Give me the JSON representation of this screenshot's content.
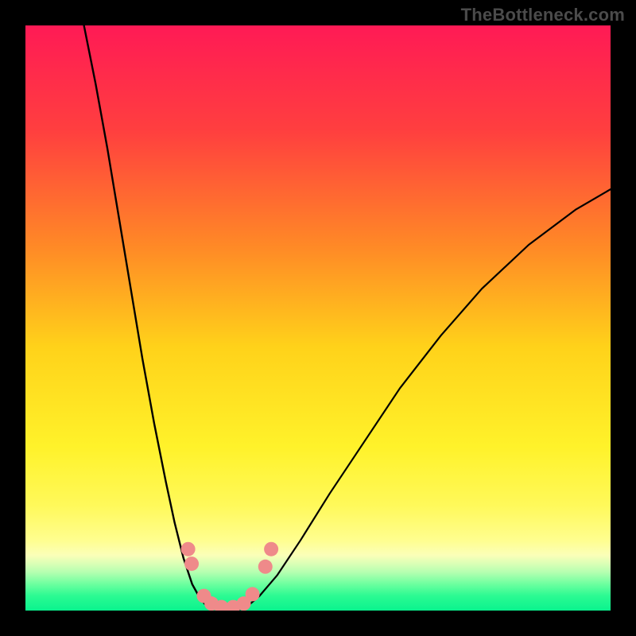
{
  "watermark": "TheBottleneck.com",
  "chart_data": {
    "type": "line",
    "title": "",
    "xlabel": "",
    "ylabel": "",
    "xlim": [
      0,
      100
    ],
    "ylim": [
      0,
      100
    ],
    "grid": false,
    "background_gradient": {
      "stops": [
        {
          "offset": 0.0,
          "color": "#ff1a55"
        },
        {
          "offset": 0.18,
          "color": "#ff3f3f"
        },
        {
          "offset": 0.38,
          "color": "#ff8a26"
        },
        {
          "offset": 0.55,
          "color": "#ffd21a"
        },
        {
          "offset": 0.72,
          "color": "#fff22a"
        },
        {
          "offset": 0.82,
          "color": "#fff95a"
        },
        {
          "offset": 0.88,
          "color": "#fffe8f"
        },
        {
          "offset": 0.905,
          "color": "#fbffb8"
        },
        {
          "offset": 0.92,
          "color": "#daffb6"
        },
        {
          "offset": 0.935,
          "color": "#b3ffb0"
        },
        {
          "offset": 0.955,
          "color": "#6cff9f"
        },
        {
          "offset": 0.975,
          "color": "#2bfa92"
        },
        {
          "offset": 1.0,
          "color": "#0af38e"
        }
      ]
    },
    "series": [
      {
        "name": "left-limb",
        "color": "#000000",
        "width": 2.4,
        "x": [
          10.0,
          12.0,
          14.0,
          16.0,
          18.0,
          20.0,
          22.0,
          24.0,
          25.5,
          27.0,
          28.5,
          30.0,
          31.0
        ],
        "y": [
          100.0,
          90.0,
          79.0,
          67.0,
          55.0,
          43.0,
          32.0,
          22.0,
          15.0,
          9.0,
          4.5,
          1.8,
          0.8
        ]
      },
      {
        "name": "right-limb",
        "color": "#000000",
        "width": 2.2,
        "x": [
          38.0,
          40.0,
          43.0,
          47.0,
          52.0,
          58.0,
          64.0,
          71.0,
          78.0,
          86.0,
          94.0,
          100.0
        ],
        "y": [
          0.8,
          2.5,
          6.0,
          12.0,
          20.0,
          29.0,
          38.0,
          47.0,
          55.0,
          62.5,
          68.5,
          72.0
        ]
      }
    ],
    "floor_path": {
      "name": "valley-floor",
      "color": "#000000",
      "width": 2.0,
      "x": [
        31.0,
        32.5,
        34.0,
        35.5,
        37.0,
        38.0
      ],
      "y": [
        0.8,
        0.25,
        0.05,
        0.05,
        0.25,
        0.8
      ]
    },
    "markers": {
      "name": "valley-markers",
      "color": "#ef8a8a",
      "radius": 9,
      "points": [
        {
          "x": 27.8,
          "y": 10.5
        },
        {
          "x": 28.4,
          "y": 8.0
        },
        {
          "x": 30.5,
          "y": 2.5
        },
        {
          "x": 31.8,
          "y": 1.2
        },
        {
          "x": 33.5,
          "y": 0.6
        },
        {
          "x": 35.5,
          "y": 0.6
        },
        {
          "x": 37.3,
          "y": 1.2
        },
        {
          "x": 38.8,
          "y": 2.8
        },
        {
          "x": 41.0,
          "y": 7.5
        },
        {
          "x": 42.0,
          "y": 10.5
        }
      ]
    }
  }
}
